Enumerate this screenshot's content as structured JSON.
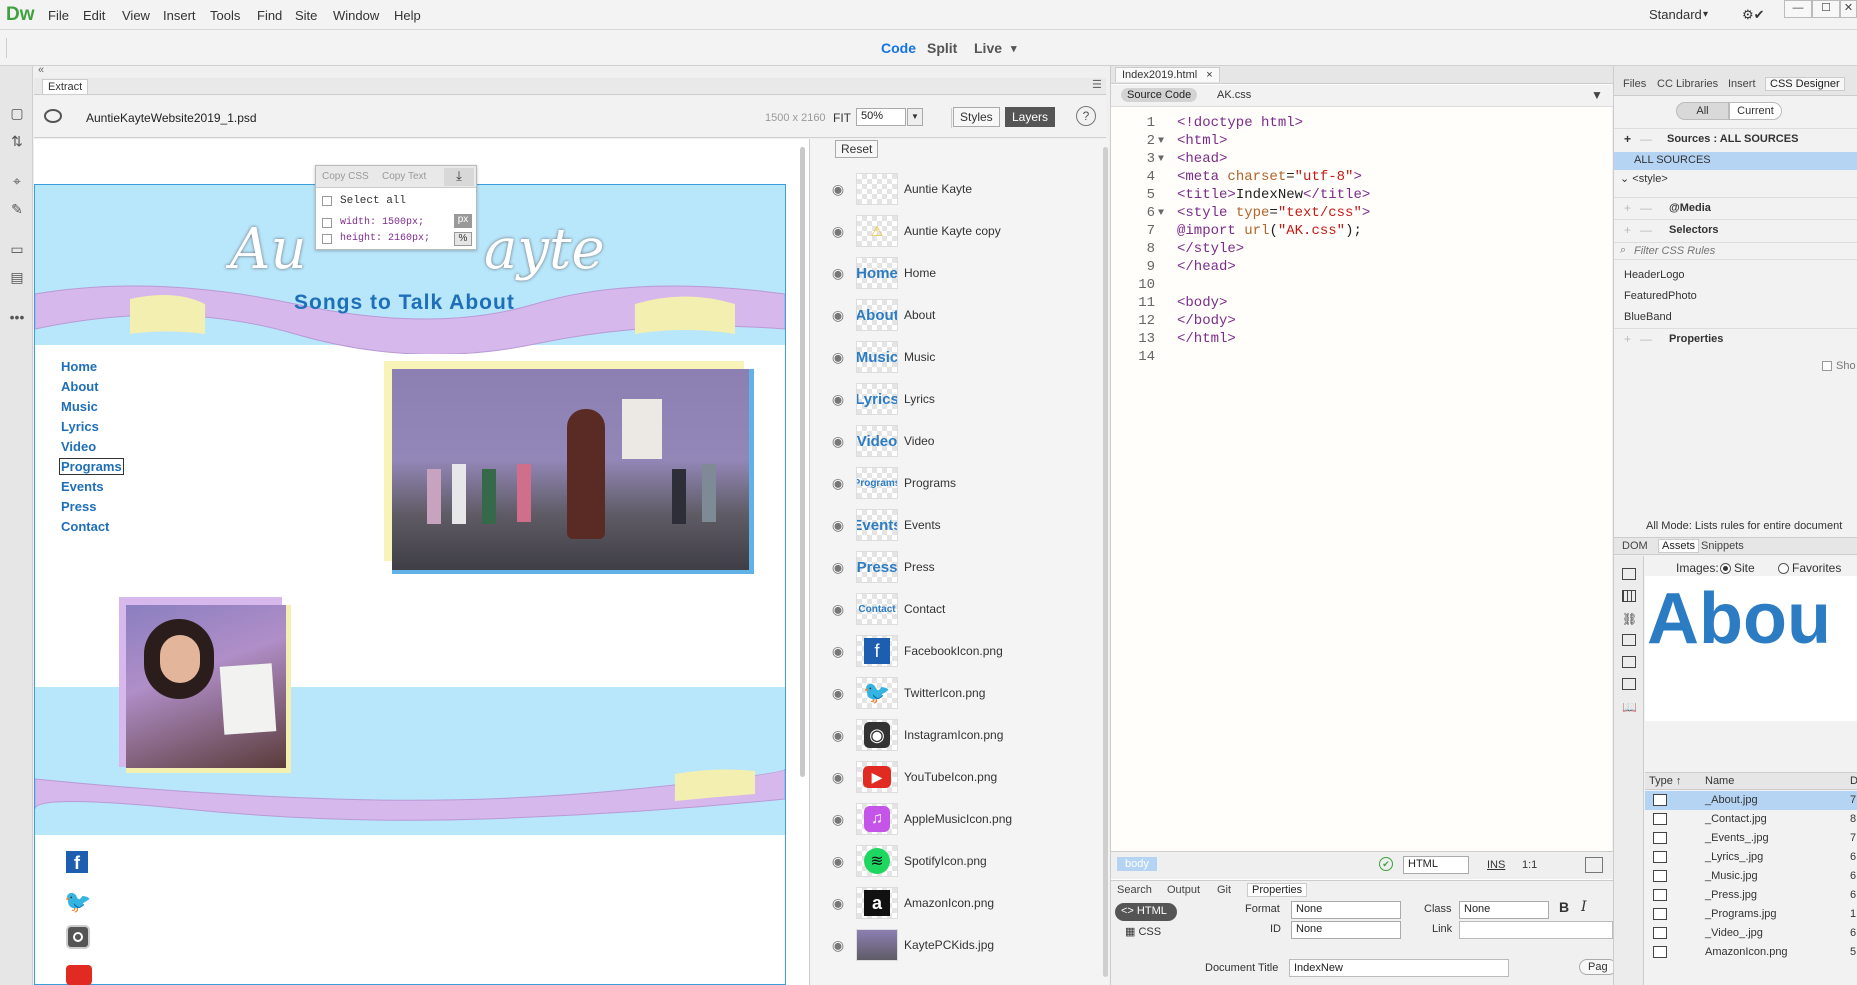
{
  "app": {
    "logo": "Dw",
    "menu": [
      "File",
      "Edit",
      "View",
      "Insert",
      "Tools",
      "Find",
      "Site",
      "Window",
      "Help"
    ],
    "workspace": "Standard",
    "workspace_caret": "▾",
    "sync_icon": "⚙✔"
  },
  "viewmodes": {
    "code": "Code",
    "split": "Split",
    "live": "Live",
    "live_caret": "▾"
  },
  "extract": {
    "panel_title": "Extract",
    "file": "AuntieKayteWebsite2019_1.psd",
    "dimensions": "1500 x 2160",
    "fit": "FIT",
    "zoom": "50%",
    "styles_btn": "Styles",
    "layers_btn": "Layers",
    "help": "?",
    "menu_icon": "☰",
    "collapse_icon": "«"
  },
  "popup": {
    "copy_css": "Copy CSS",
    "copy_text": "Copy Text",
    "download": "⤓",
    "select_all": "Select all",
    "width_line": "width: 1500px;",
    "height_line": "height: 2160px;",
    "unit_px": "px",
    "unit_pct": "%"
  },
  "website": {
    "title_left": "Au",
    "title_right": "ayte",
    "tagline": "Songs to Talk About",
    "nav": [
      "Home",
      "About",
      "Music",
      "Lyrics",
      "Video",
      "Programs",
      "Events",
      "Press",
      "Contact"
    ]
  },
  "layers": {
    "reset": "Reset",
    "items": [
      {
        "name": "Auntie Kayte",
        "thumb": ""
      },
      {
        "name": "Auntie Kayte copy",
        "thumb": "⚠"
      },
      {
        "name": "Home",
        "thumb": "Home"
      },
      {
        "name": "About",
        "thumb": "About"
      },
      {
        "name": "Music",
        "thumb": "Music"
      },
      {
        "name": "Lyrics",
        "thumb": "Lyrics"
      },
      {
        "name": "Video",
        "thumb": "Video"
      },
      {
        "name": "Programs",
        "thumb": "Programs"
      },
      {
        "name": "Events",
        "thumb": "Events"
      },
      {
        "name": "Press",
        "thumb": "Press"
      },
      {
        "name": "Contact",
        "thumb": "Contact"
      },
      {
        "name": "FacebookIcon.png",
        "thumb": "f"
      },
      {
        "name": "TwitterIcon.png",
        "thumb": "🐦"
      },
      {
        "name": "InstagramIcon.png",
        "thumb": "◉"
      },
      {
        "name": "YouTubeIcon.png",
        "thumb": "▶"
      },
      {
        "name": "AppleMusicIcon.png",
        "thumb": "♫"
      },
      {
        "name": "SpotifyIcon.png",
        "thumb": "≋"
      },
      {
        "name": "AmazonIcon.png",
        "thumb": "a"
      },
      {
        "name": "KaytePCKids.jpg",
        "thumb": ""
      }
    ]
  },
  "editor": {
    "tab": "Index2019.html",
    "close": "×",
    "source_code": "Source Code",
    "css_file": "AK.css",
    "filter": "▼",
    "lines": [
      {
        "n": "1",
        "fold": ""
      },
      {
        "n": "2",
        "fold": "▼"
      },
      {
        "n": "3",
        "fold": "▼"
      },
      {
        "n": "4",
        "fold": ""
      },
      {
        "n": "5",
        "fold": ""
      },
      {
        "n": "6",
        "fold": "▼"
      },
      {
        "n": "7",
        "fold": ""
      },
      {
        "n": "8",
        "fold": ""
      },
      {
        "n": "9",
        "fold": ""
      },
      {
        "n": "10",
        "fold": ""
      },
      {
        "n": "11",
        "fold": ""
      },
      {
        "n": "12",
        "fold": ""
      },
      {
        "n": "13",
        "fold": ""
      },
      {
        "n": "14",
        "fold": ""
      }
    ],
    "status": {
      "tag": "body",
      "lang": "HTML",
      "ins": "INS",
      "pos": "1:1",
      "check": "✔"
    }
  },
  "properties": {
    "tabs": [
      "Search",
      "Output",
      "Git",
      "Properties"
    ],
    "html_btn": "HTML",
    "css_btn": "CSS",
    "format_label": "Format",
    "format_val": "None",
    "id_label": "ID",
    "id_val": "None",
    "class_label": "Class",
    "class_val": "None",
    "link_label": "Link",
    "bold": "B",
    "italic": "I",
    "doc_title_label": "Document Title",
    "doc_title_val": "IndexNew",
    "page_btn": "Pag"
  },
  "cssdesigner": {
    "tabs": [
      "Files",
      "CC Libraries",
      "Insert",
      "CSS Designer"
    ],
    "all": "All",
    "current": "Current",
    "sources": "Sources :  ALL SOURCES",
    "all_sources": "ALL SOURCES",
    "style": "<style>",
    "media": "@Media",
    "selectors": "Selectors",
    "filter_ph": "Filter CSS Rules",
    "rules": [
      "HeaderLogo",
      "FeaturedPhoto",
      "BlueBand"
    ],
    "properties": "Properties",
    "show": "Sho",
    "mode_msg": "All Mode: Lists rules for entire document"
  },
  "assets": {
    "tabs": [
      "DOM",
      "Assets",
      "Snippets"
    ],
    "images_label": "Images:",
    "site": "Site",
    "favorites": "Favorites",
    "preview_text": "Abou",
    "col_type": "Type",
    "col_name": "Name",
    "col_d": "D",
    "rows": [
      {
        "name": "_About.jpg",
        "d": "7"
      },
      {
        "name": "_Contact.jpg",
        "d": "8"
      },
      {
        "name": "_Events_.jpg",
        "d": "7"
      },
      {
        "name": "_Lyrics_.jpg",
        "d": "6"
      },
      {
        "name": "_Music.jpg",
        "d": "6"
      },
      {
        "name": "_Press.jpg",
        "d": "6"
      },
      {
        "name": "_Programs.jpg",
        "d": "1"
      },
      {
        "name": "_Video_.jpg",
        "d": "6"
      },
      {
        "name": "AmazonIcon.png",
        "d": "5"
      }
    ]
  },
  "colors": {
    "accent": "#1473e6",
    "sky": "#b8e6fb",
    "ribbon": "#d6b8ec",
    "navblue": "#1f6fb8",
    "selection": "#b5d4f4"
  }
}
